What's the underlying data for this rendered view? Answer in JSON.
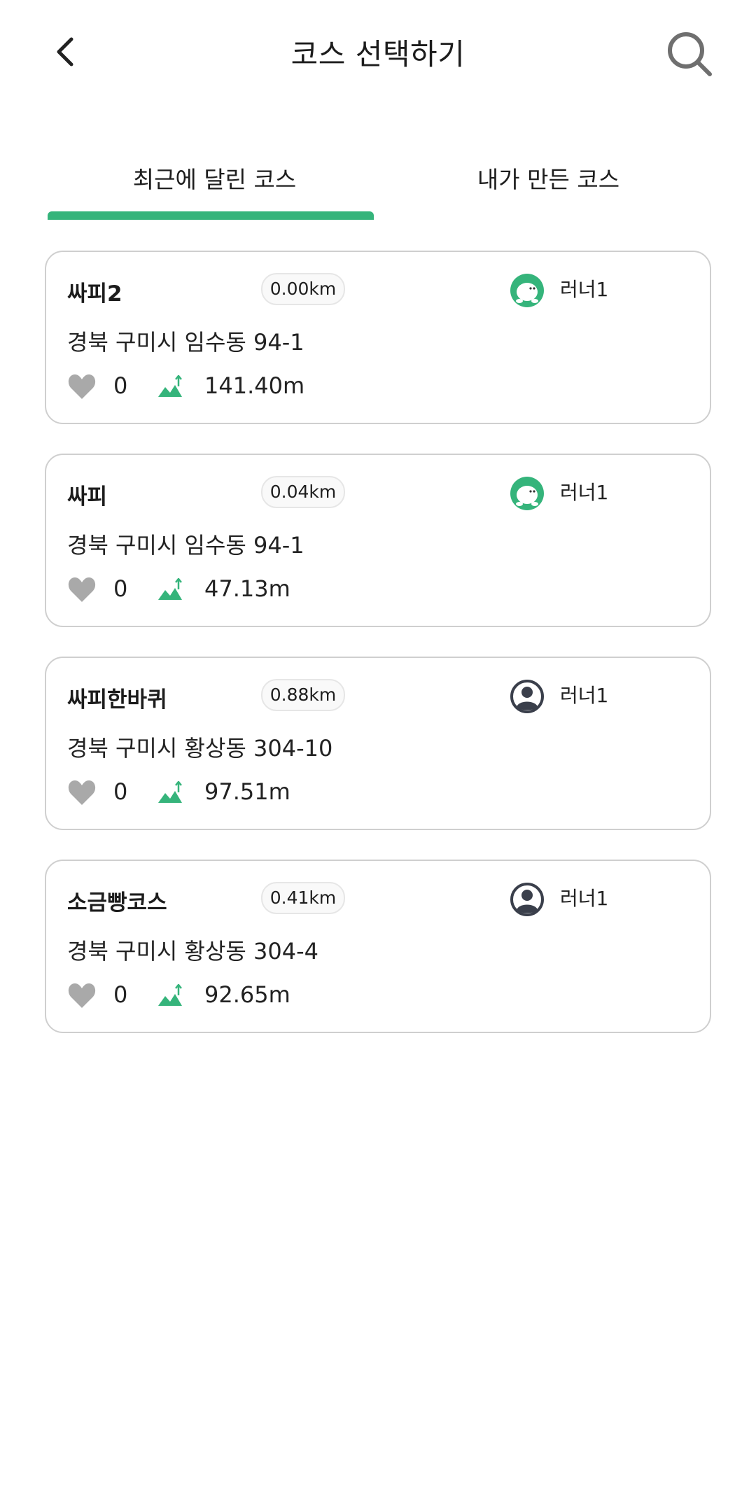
{
  "header": {
    "title": "코스 선택하기",
    "back_icon": "chevron-left-icon",
    "search_icon": "search-icon"
  },
  "tabs": [
    {
      "label": "최근에 달린 코스",
      "active": true
    },
    {
      "label": "내가 만든 코스",
      "active": false
    }
  ],
  "colors": {
    "accent": "#35b47b",
    "heart": "#a9a9a9",
    "avatar_dark": "#3a3f4b"
  },
  "courses": [
    {
      "name": "싸피2",
      "distance": "0.00km",
      "runner": "러너1",
      "avatar": "green-character-avatar",
      "address": "경북 구미시 임수동 94-1",
      "likes": "0",
      "elevation": "141.40m"
    },
    {
      "name": "싸피",
      "distance": "0.04km",
      "runner": "러너1",
      "avatar": "green-character-avatar",
      "address": "경북 구미시 임수동 94-1",
      "likes": "0",
      "elevation": "47.13m"
    },
    {
      "name": "싸피한바퀴",
      "distance": "0.88km",
      "runner": "러너1",
      "avatar": "default-user-avatar",
      "address": "경북 구미시 황상동 304-10",
      "likes": "0",
      "elevation": "97.51m"
    },
    {
      "name": "소금빵코스",
      "distance": "0.41km",
      "runner": "러너1",
      "avatar": "default-user-avatar",
      "address": "경북 구미시 황상동 304-4",
      "likes": "0",
      "elevation": "92.65m"
    }
  ]
}
